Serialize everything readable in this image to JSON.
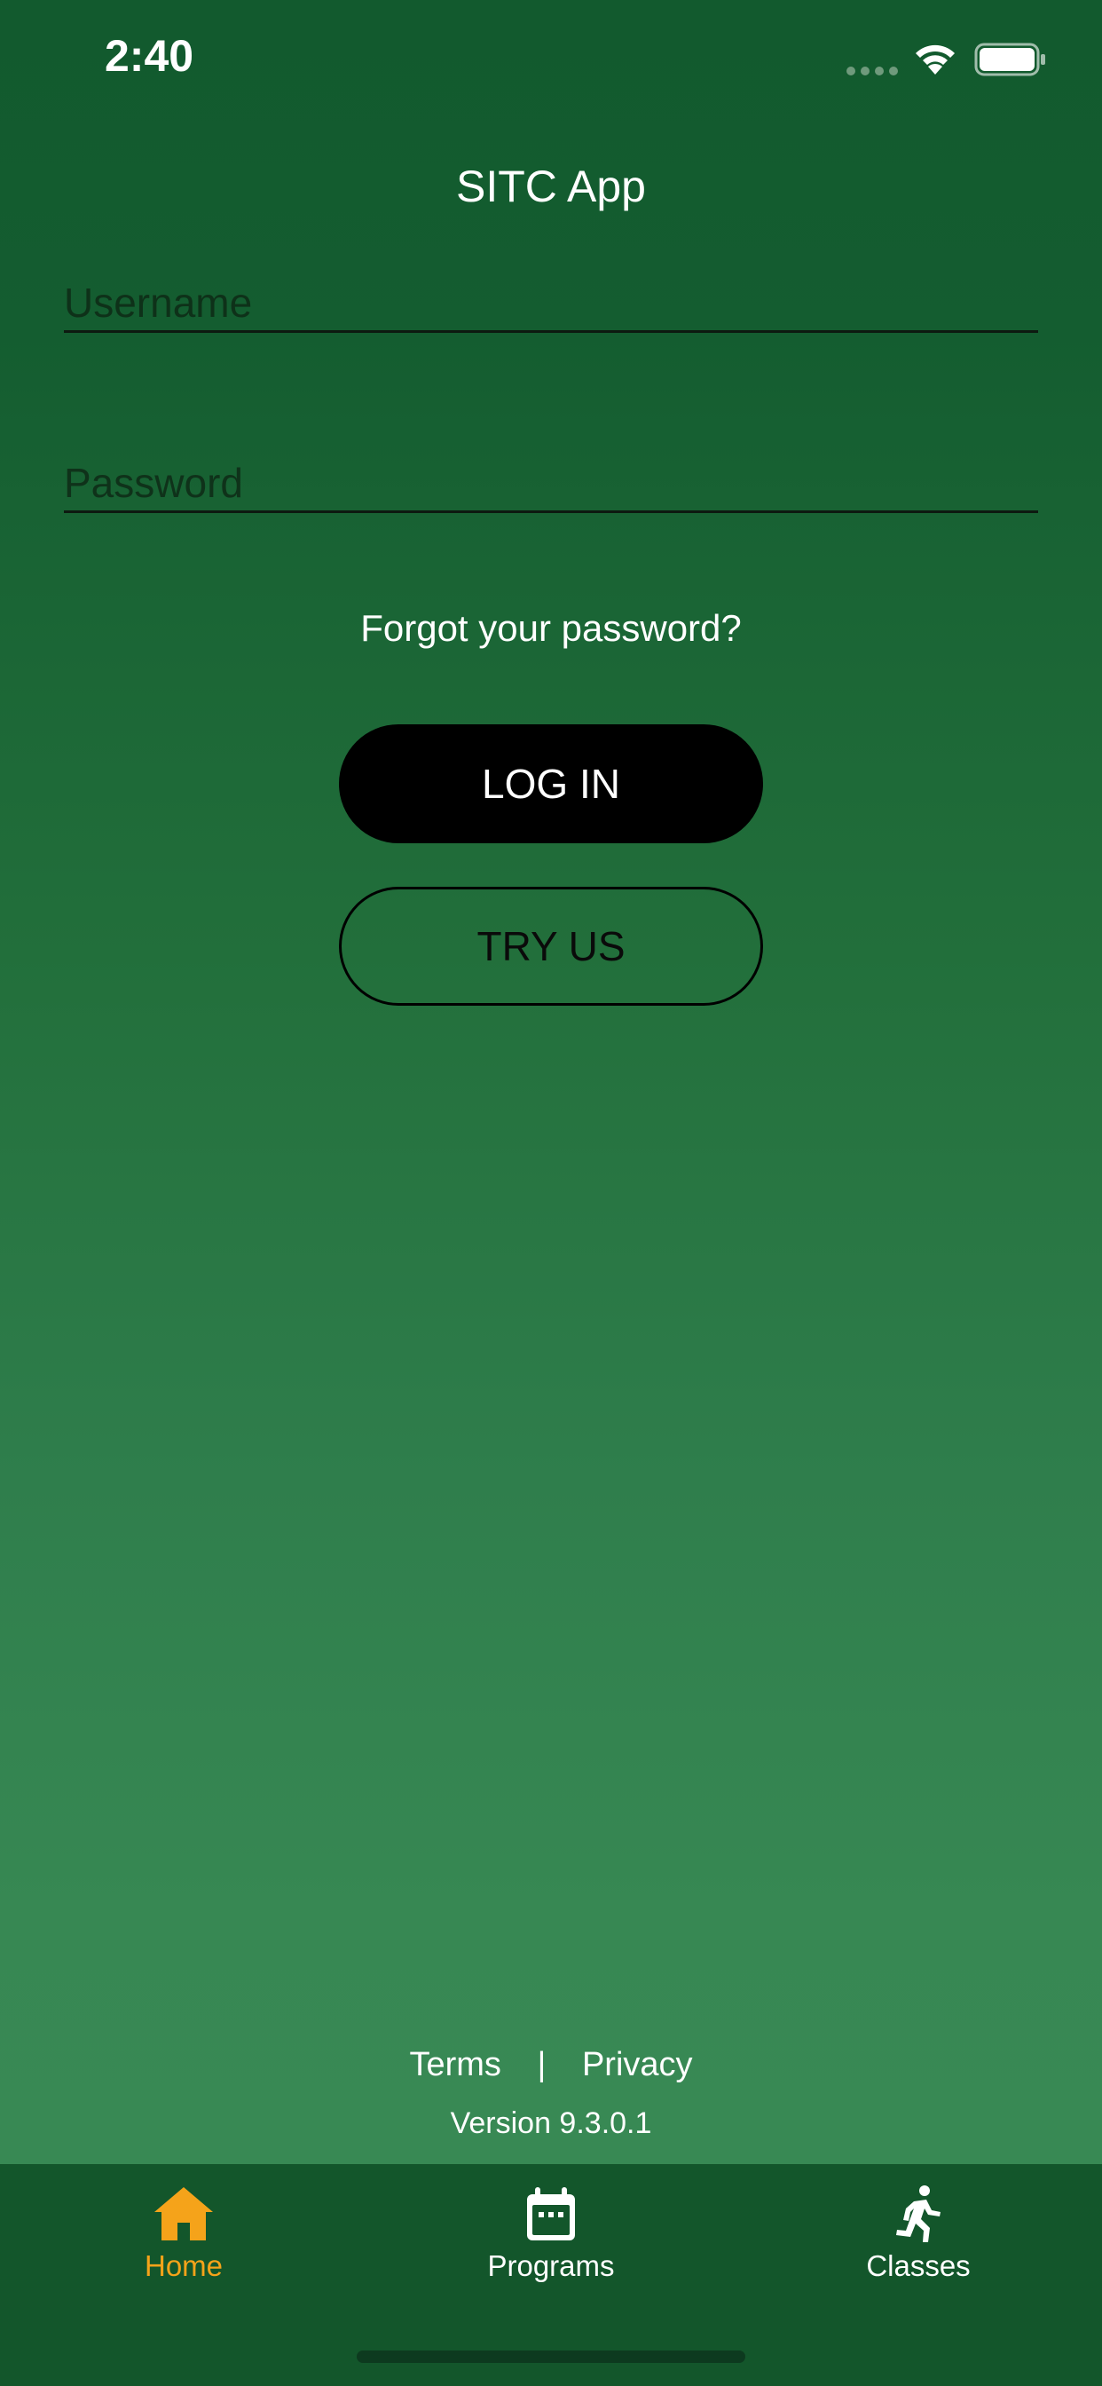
{
  "status_bar": {
    "time": "2:40"
  },
  "app": {
    "title": "SITC App"
  },
  "login_form": {
    "username_placeholder": "Username",
    "password_placeholder": "Password",
    "forgot_password": "Forgot your password?",
    "login_label": "LOG IN",
    "try_label": "TRY US"
  },
  "footer": {
    "terms": "Terms",
    "separator": "|",
    "privacy": "Privacy",
    "version": "Version 9.3.0.1"
  },
  "tab_bar": {
    "items": [
      {
        "label": "Home",
        "icon": "home-icon",
        "active": true
      },
      {
        "label": "Programs",
        "icon": "calendar-icon",
        "active": false
      },
      {
        "label": "Classes",
        "icon": "running-person-icon",
        "active": false
      }
    ]
  },
  "colors": {
    "background_top": "#125a2e",
    "background_bottom": "#398a55",
    "tab_bar": "#13562b",
    "active_tab": "#f5a31a",
    "login_button": "#000000"
  }
}
